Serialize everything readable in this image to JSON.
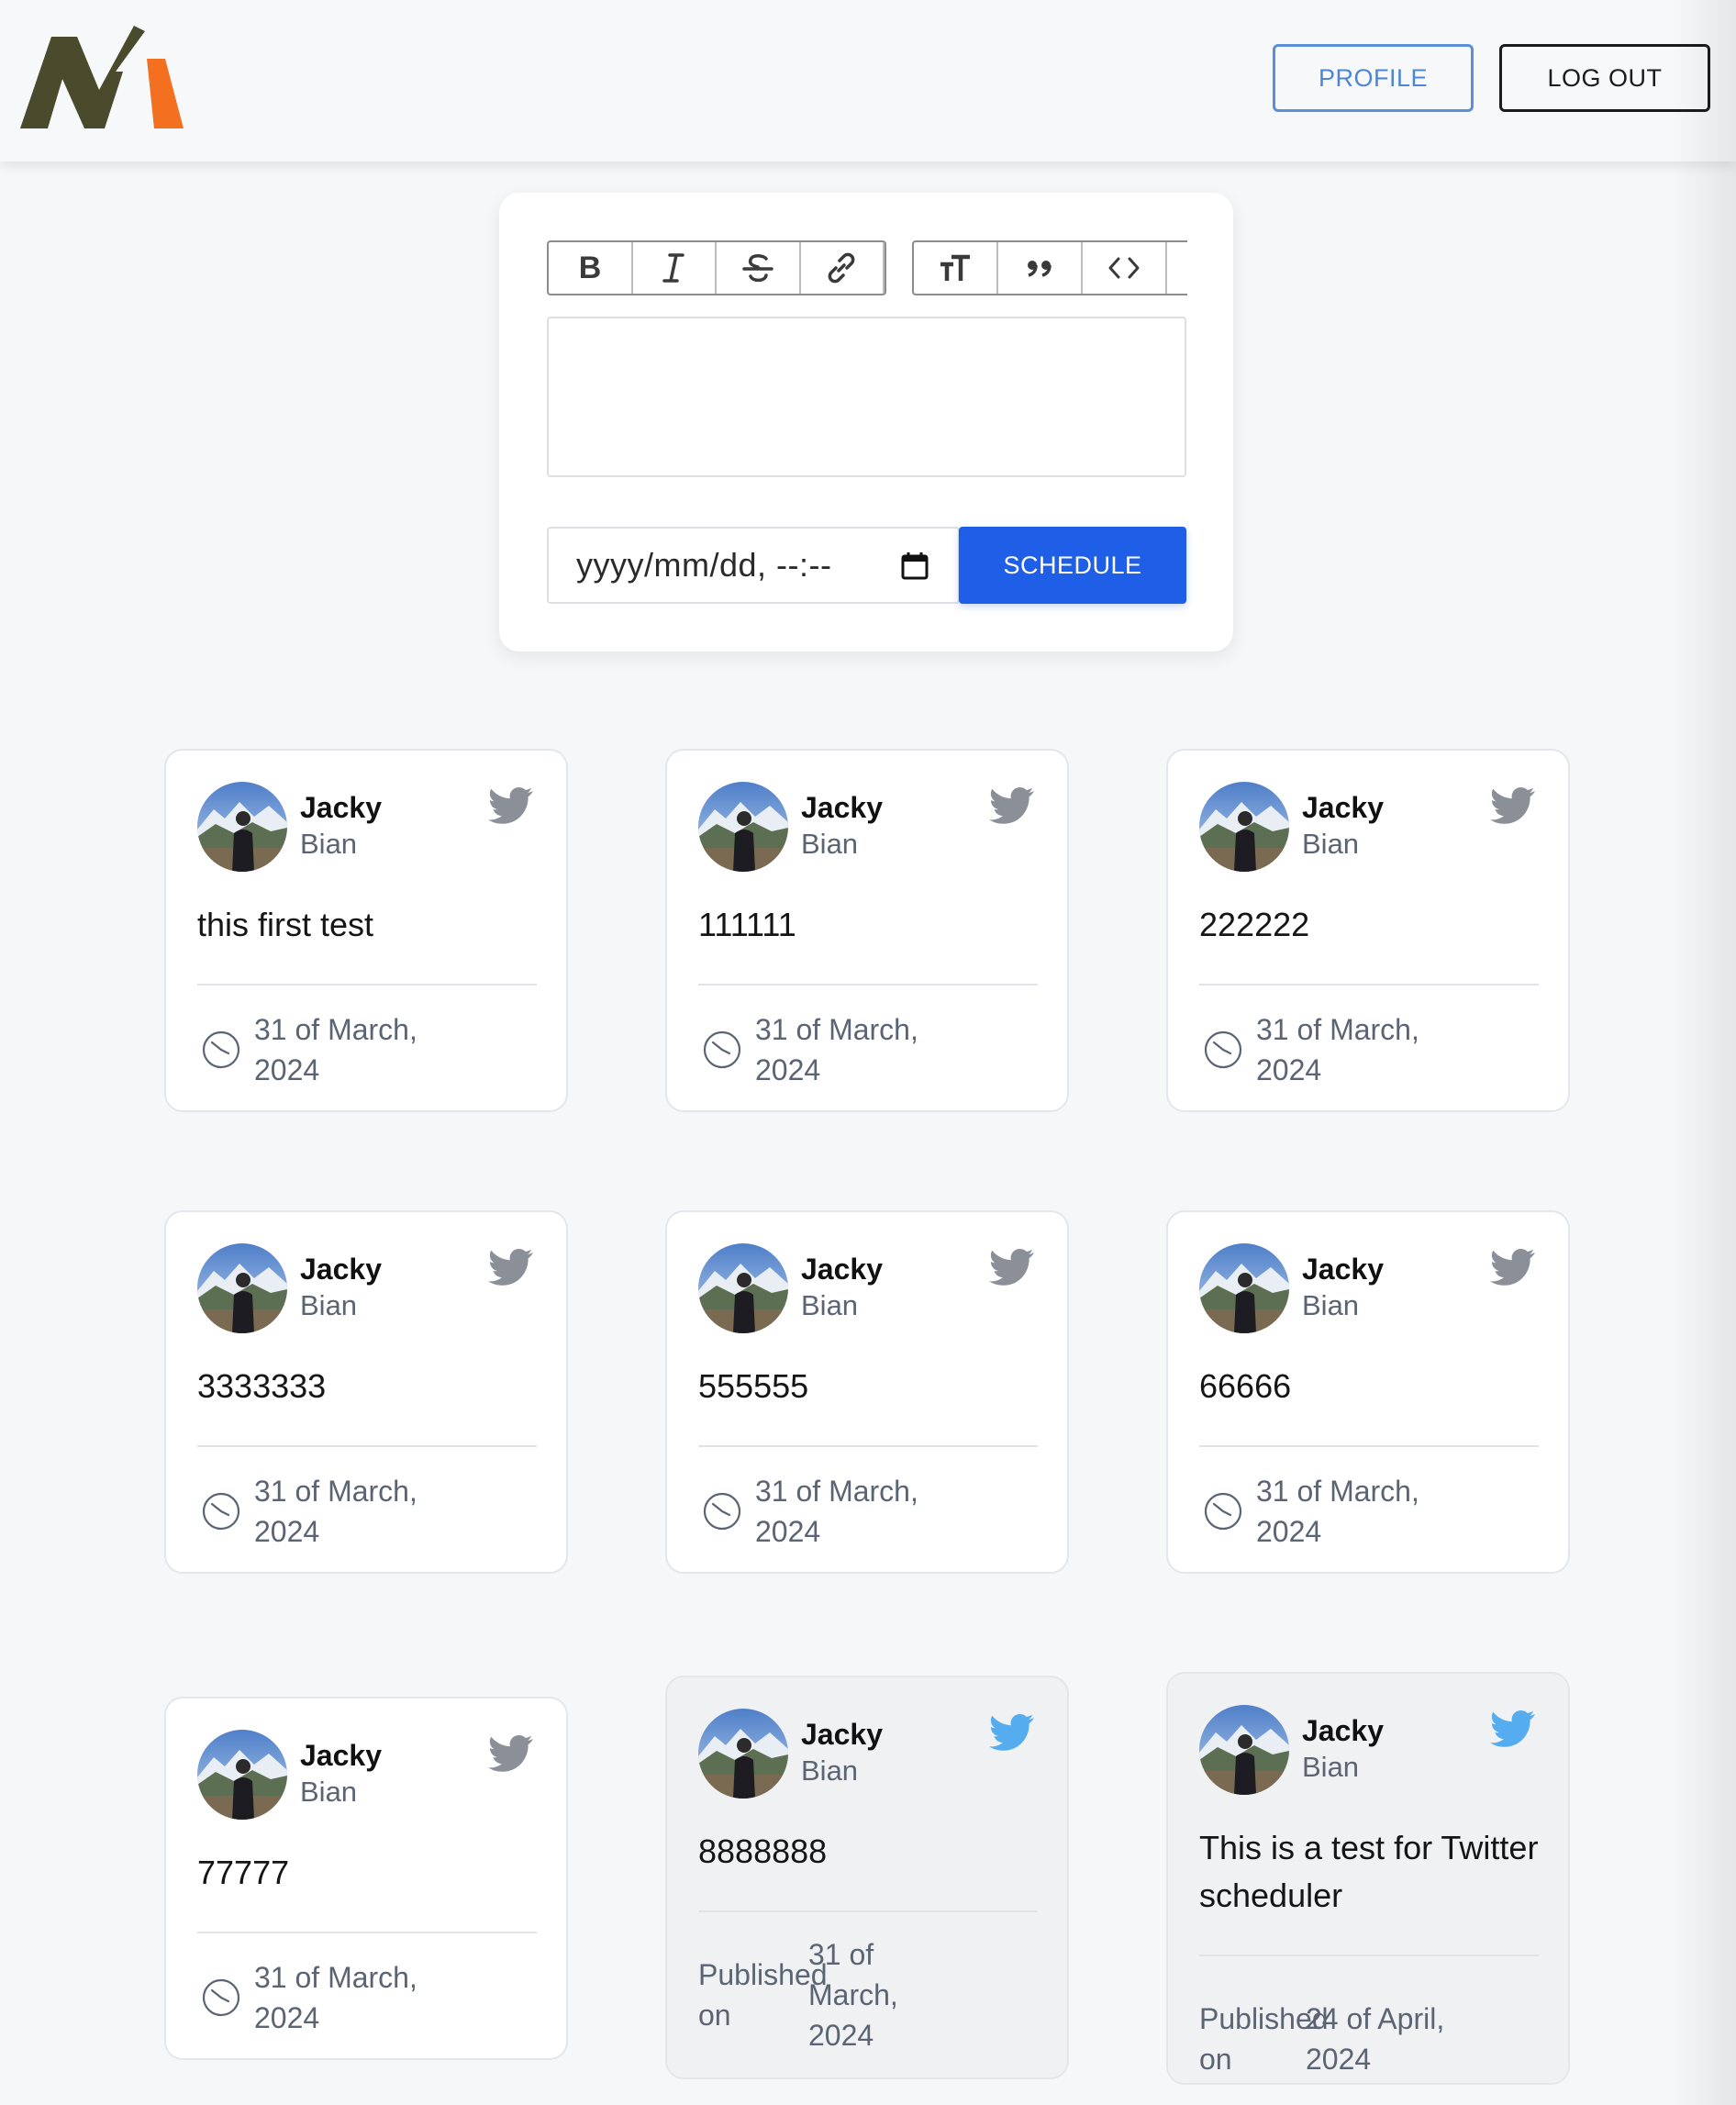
{
  "header": {
    "logo_alt": "logo",
    "profile_label": "PROFILE",
    "logout_label": "LOG OUT"
  },
  "editor": {
    "toolbar": [
      {
        "name": "bold-button",
        "icon": "bold-icon"
      },
      {
        "name": "italic-button",
        "icon": "italic-icon"
      },
      {
        "name": "strikethrough-button",
        "icon": "strikethrough-icon"
      },
      {
        "name": "link-button",
        "icon": "link-icon"
      },
      {
        "name": "heading-button",
        "icon": "heading-icon"
      },
      {
        "name": "quote-button",
        "icon": "quote-icon"
      },
      {
        "name": "code-button",
        "icon": "code-icon"
      }
    ],
    "editor_text": "",
    "date_placeholder": "yyyy/mm/dd, --:--",
    "schedule_label": "SCHEDULE"
  },
  "colors": {
    "accent": "#1f5ee6",
    "profile_border": "#5b8fd8",
    "twitter_blue": "#55acee",
    "twitter_gray": "#8a8f98",
    "logo_dark": "#4a4b2c",
    "logo_orange": "#f37021"
  },
  "posts": [
    {
      "first": "Jacky",
      "last": "Bian",
      "text": "this first test",
      "date": "31 of March, 2024",
      "status": "scheduled"
    },
    {
      "first": "Jacky",
      "last": "Bian",
      "text": "111111",
      "date": "31 of March, 2024",
      "status": "scheduled"
    },
    {
      "first": "Jacky",
      "last": "Bian",
      "text": "222222",
      "date": "31 of March, 2024",
      "status": "scheduled"
    },
    {
      "first": "Jacky",
      "last": "Bian",
      "text": "3333333",
      "date": "31 of March, 2024",
      "status": "scheduled"
    },
    {
      "first": "Jacky",
      "last": "Bian",
      "text": "555555",
      "date": "31 of March, 2024",
      "status": "scheduled"
    },
    {
      "first": "Jacky",
      "last": "Bian",
      "text": "66666",
      "date": "31 of March, 2024",
      "status": "scheduled"
    },
    {
      "first": "Jacky",
      "last": "Bian",
      "text": "77777",
      "date": "31 of March, 2024",
      "status": "scheduled"
    },
    {
      "first": "Jacky",
      "last": "Bian",
      "text": "8888888",
      "date": "31 of March, 2024",
      "status": "published",
      "published_label": "Published on"
    },
    {
      "first": "Jacky",
      "last": "Bian",
      "text": "This is a test for Twitter scheduler",
      "date": "24 of April, 2024",
      "status": "published",
      "published_label": "Published on"
    }
  ]
}
